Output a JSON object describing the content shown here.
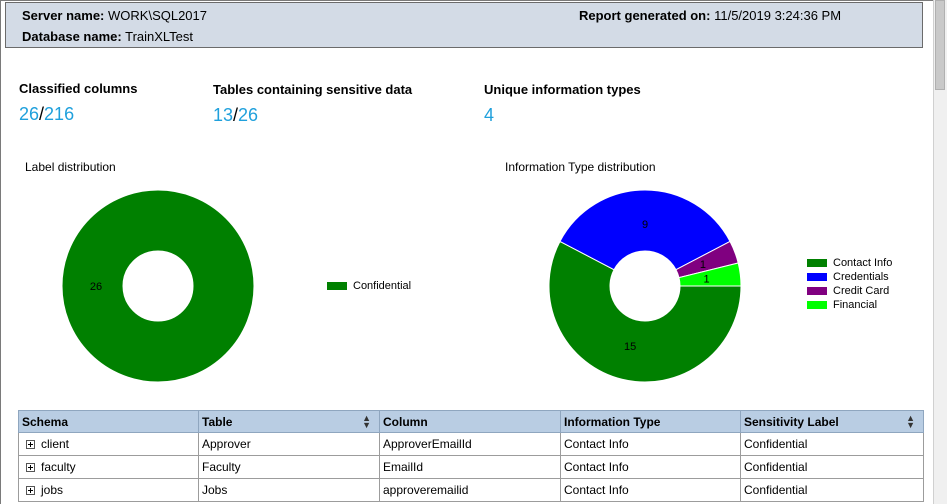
{
  "header": {
    "server_label": "Server name:",
    "server_value": "WORK\\SQL2017",
    "report_label": "Report generated on:",
    "report_value": "11/5/2019 3:24:36 PM",
    "database_label": "Database name:",
    "database_value": "TrainXLTest"
  },
  "metrics": {
    "classified": {
      "label": "Classified columns",
      "value": "26",
      "total": "216"
    },
    "tables": {
      "label": "Tables containing sensitive data",
      "value": "13",
      "total": "26"
    },
    "info_types": {
      "label": "Unique information types",
      "value": "4"
    },
    "separator": "/"
  },
  "chart_data": [
    {
      "type": "pie",
      "title": "Label distribution",
      "categories": [
        "Confidential"
      ],
      "values": [
        26
      ],
      "colors": [
        "#008000"
      ],
      "legend": "right"
    },
    {
      "type": "pie",
      "title": "Information Type distribution",
      "categories": [
        "Contact Info",
        "Credentials",
        "Credit Card",
        "Financial"
      ],
      "values": [
        15,
        9,
        1,
        1
      ],
      "colors": [
        "#008000",
        "#0000ff",
        "#800080",
        "#00ff00"
      ],
      "legend": "right"
    }
  ],
  "table": {
    "columns": [
      {
        "label": "Schema",
        "sortable": false
      },
      {
        "label": "Table",
        "sortable": true
      },
      {
        "label": "Column",
        "sortable": false
      },
      {
        "label": "Information Type",
        "sortable": false
      },
      {
        "label": "Sensitivity Label",
        "sortable": true
      }
    ],
    "rows": [
      [
        "client",
        "Approver",
        "ApproverEmailId",
        "Contact Info",
        "Confidential"
      ],
      [
        "faculty",
        "Faculty",
        "EmailId",
        "Contact Info",
        "Confidential"
      ],
      [
        "jobs",
        "Jobs",
        "approveremailid",
        "Contact Info",
        "Confidential"
      ]
    ]
  }
}
